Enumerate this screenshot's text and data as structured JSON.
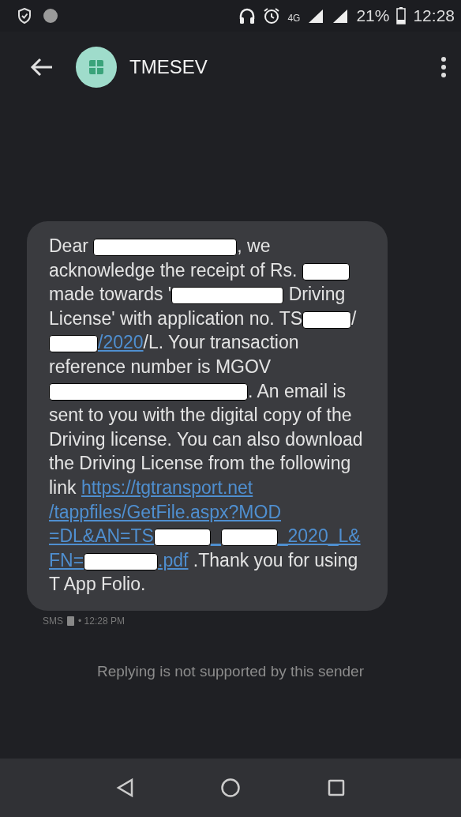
{
  "status_bar": {
    "network": "4G",
    "battery": "21%",
    "time": "12:28"
  },
  "app_bar": {
    "title": "TMESEV"
  },
  "message": {
    "segments": [
      {
        "kind": "text",
        "text": "Dear "
      },
      {
        "kind": "redacted"
      },
      {
        "kind": "text",
        "text": ", we acknowledge the receipt of Rs. "
      },
      {
        "kind": "redacted"
      },
      {
        "kind": "text",
        "text": " made towards '"
      },
      {
        "kind": "redacted"
      },
      {
        "kind": "text",
        "text": " Driving License' with application no. TS"
      },
      {
        "kind": "redacted"
      },
      {
        "kind": "text",
        "text": "/"
      },
      {
        "kind": "redacted"
      },
      {
        "kind": "link",
        "text": "/2020"
      },
      {
        "kind": "text",
        "text": "/L. Your transaction reference number is MGOV"
      },
      {
        "kind": "redacted"
      },
      {
        "kind": "text",
        "text": ".  An email is sent to you with the digital copy of the Driving license. You can also download the Driving License from the following link "
      },
      {
        "kind": "link",
        "text": "https://tgtransport.net"
      },
      {
        "kind": "link",
        "text": "/tappfiles/GetFile.aspx?MOD"
      },
      {
        "kind": "link",
        "text": "=DL&AN=TS"
      },
      {
        "kind": "redacted"
      },
      {
        "kind": "link",
        "text": "_"
      },
      {
        "kind": "redacted"
      },
      {
        "kind": "link",
        "text": "_2020_L&"
      },
      {
        "kind": "link",
        "text": "FN="
      },
      {
        "kind": "redacted"
      },
      {
        "kind": "link",
        "text": ".pdf"
      },
      {
        "kind": "text",
        "text": " .Thank you for using T App Folio."
      }
    ],
    "meta_label": "SMS",
    "time": "• 12:28 PM"
  },
  "notice": "Replying is not supported by this sender"
}
